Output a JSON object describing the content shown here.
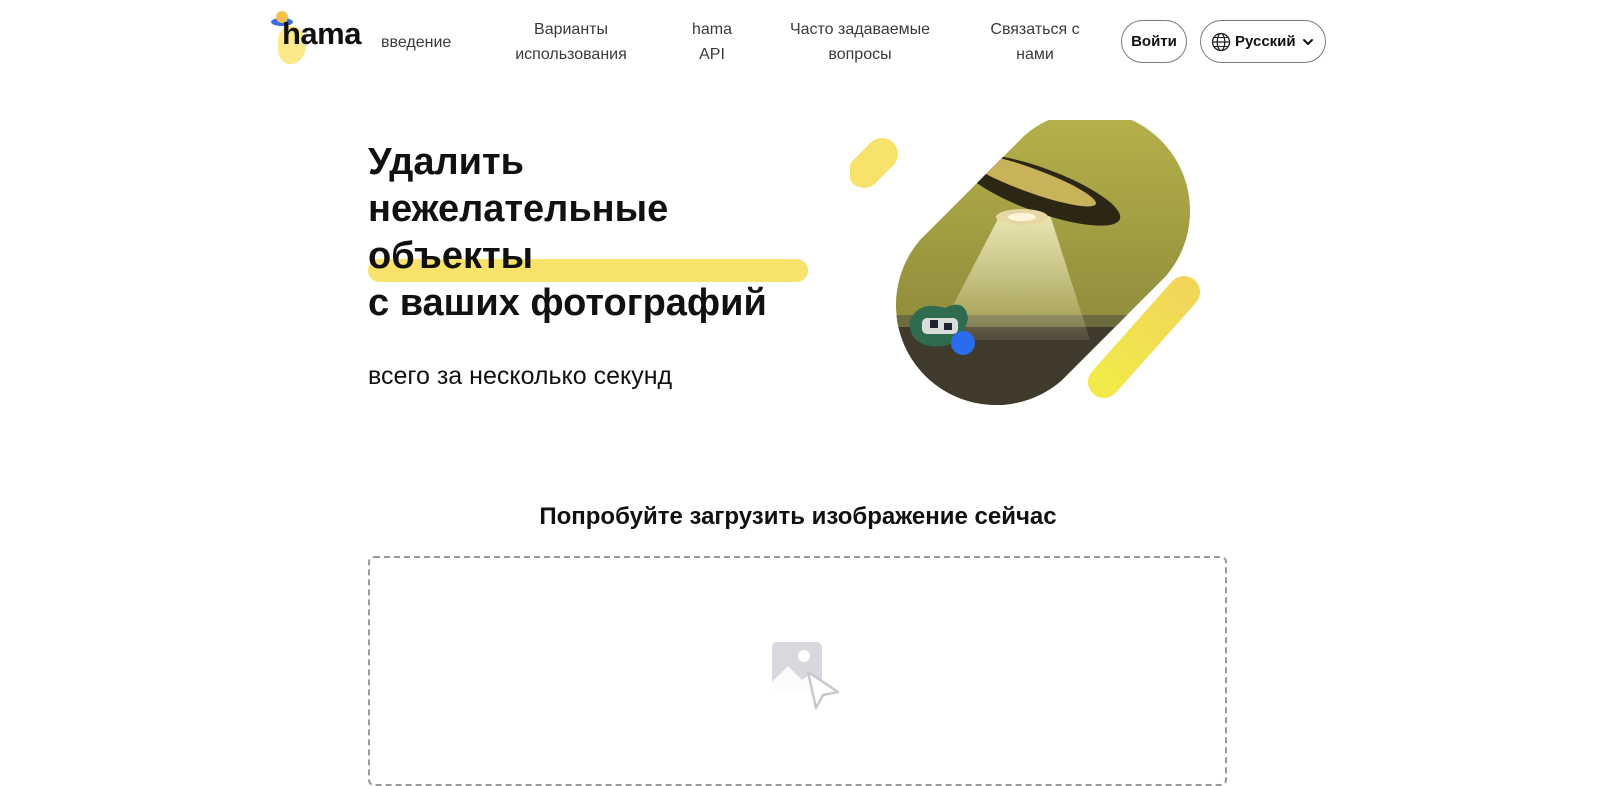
{
  "header": {
    "logo_text": "hama",
    "nav": {
      "intro": "введение",
      "usage": "Варианты использования",
      "api": "hama API",
      "faq": "Часто задаваемые вопросы",
      "contact": "Связаться с нами"
    },
    "login_label": "Войти",
    "language": {
      "selected": "Русский",
      "icon": "globe-icon"
    }
  },
  "hero": {
    "title_lines": [
      "Удалить",
      "нежелательные",
      "объекты",
      "с ваших фотографий"
    ],
    "subtitle": "всего за несколько секунд",
    "image": "ufo-beaming-cow-illustration"
  },
  "upload": {
    "heading": "Попробуйте загрузить изображение сейчас",
    "icon": "image-upload-icon"
  },
  "colors": {
    "accent_yellow": "#f7e26b",
    "border_gray": "#7a7a7a",
    "dot_blue": "#2b6bf0"
  }
}
